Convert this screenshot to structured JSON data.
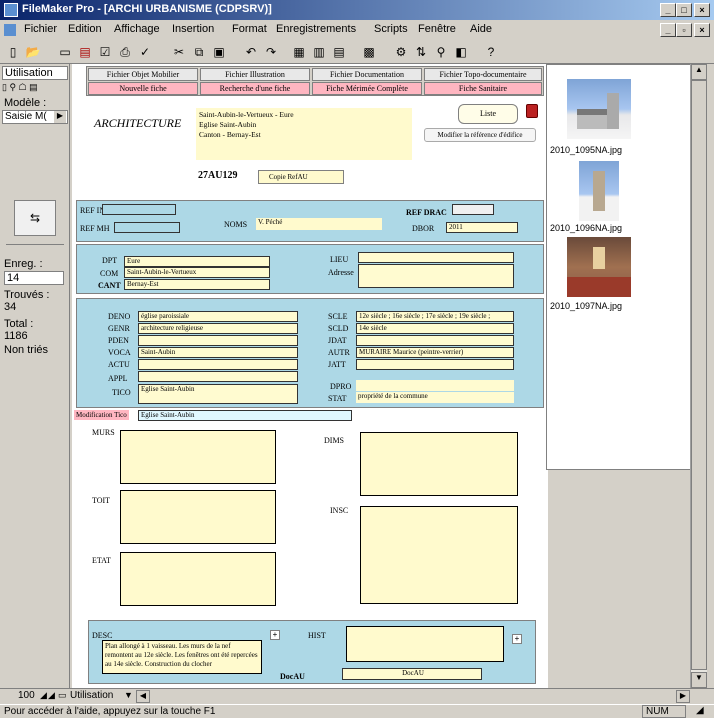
{
  "window": {
    "title": "FileMaker Pro - [ARCHI URBANISME (CDPSRV)]"
  },
  "menu": [
    "Fichier",
    "Edition",
    "Affichage",
    "Insertion",
    "Format",
    "Enregistrements",
    "Scripts",
    "Fenêtre",
    "Aide"
  ],
  "toolbar": {
    "icons": [
      "new-doc-icon",
      "open-icon",
      "save-icon",
      "db-icon",
      "check-icon",
      "print-icon",
      "spell-icon",
      "cut-icon",
      "copy-icon",
      "paste-icon",
      "undo-icon",
      "redo-icon",
      "table-icon",
      "form-icon",
      "list-icon",
      "chart-icon",
      "layout-icon",
      "sort-icon",
      "find-icon",
      "record-icon",
      "help-icon"
    ]
  },
  "status": {
    "mode": "Utilisation",
    "layout_label": "Modèle :",
    "layout_value": "Saisie M(",
    "record_label": "Enreg. :",
    "record_value": "14",
    "found_label": "Trouvés :",
    "found_value": "34",
    "total_label": "Total :",
    "total_value": "1186",
    "sort": "Non triés"
  },
  "nav": {
    "row1": [
      "Fichier Objet Mobilier",
      "Fichier Illustration",
      "Fichier Documentation",
      "Fichier Topo-documentaire"
    ],
    "row2": [
      "Nouvelle fiche",
      "Recherche d'une fiche",
      "Fiche Mérimée Complète",
      "Fiche Sanitaire"
    ]
  },
  "header": {
    "title": "ARCHITECTURE",
    "address": "Saint-Aubin-le-Vertueux - Eure\nEglise Saint-Aubin\nCanton - Bernay-Est",
    "liste": "Liste",
    "modifier": "Modifier la référence d'édifice",
    "ref": "27AU129",
    "copy": "Copie RefAU"
  },
  "refs": {
    "refinv_label": "REF INV",
    "refinv": "",
    "refmh_label": "REF MH",
    "refmh": "",
    "noms_label": "NOMS",
    "noms": "V. Péché",
    "refdrac_label": "REF DRAC",
    "refdrac": "",
    "dbor_label": "DBOR",
    "dbor": "2011"
  },
  "location": {
    "dpt_label": "DPT",
    "dpt": "Eure",
    "com_label": "COM",
    "com": "Saint-Aubin-le-Vertueux",
    "cant_label": "CANT",
    "cant": "Bernay-Est",
    "lieu_label": "LIEU",
    "lieu": "",
    "adresse_label": "Adresse",
    "adresse": ""
  },
  "desc": {
    "deno_label": "DENO",
    "deno": "église paroissiale",
    "genr_label": "GENR",
    "genr": "architecture religieuse",
    "pden_label": "PDEN",
    "pden": "",
    "voca_label": "VOCA",
    "voca": "Saint-Aubin",
    "actu_label": "ACTU",
    "actu": "",
    "appl_label": "APPL",
    "appl": "",
    "tico_label": "TICO",
    "tico": "Eglise Saint-Aubin",
    "scle_label": "SCLE",
    "scle": "12e siècle ; 16e siècle ; 17e siècle ; 19e siècle ;",
    "scld_label": "SCLD",
    "scld": "14e siècle",
    "jdat_label": "JDAT",
    "jdat": "",
    "autr_label": "AUTR",
    "autr": "MURAIRE Maurice (peintre-verrier)",
    "jatt_label": "JATT",
    "jatt": "",
    "dpro_label": "DPRO",
    "dpro": "",
    "stat_label": "STAT",
    "stat": "propriété de la commune",
    "modif_label": "Modification Tico",
    "modif": "Eglise Saint-Aubin"
  },
  "structure": {
    "murs": "MURS",
    "toit": "TOIT",
    "etat": "ETAT",
    "dims": "DIMS",
    "insc": "INSC"
  },
  "bottom": {
    "desc_label": "DESC",
    "desc_text": "Plan allongé à 1 vaisseau. Les murs de la nef remontent au 12e siècle. Les fenêtres ont été repercées au 14e siècle. Construction du clocher",
    "hist_label": "HIST",
    "docau_label": "DocAU",
    "docau": "DocAU"
  },
  "images": [
    {
      "caption": "2010_1095NA.jpg"
    },
    {
      "caption": "2010_1096NA.jpg"
    },
    {
      "caption": "2010_1097NA.jpg"
    }
  ],
  "footer": {
    "zoom": "100",
    "mode": "Utilisation",
    "help": "Pour accéder à l'aide, appuyez sur la touche F1",
    "num": "NUM"
  }
}
